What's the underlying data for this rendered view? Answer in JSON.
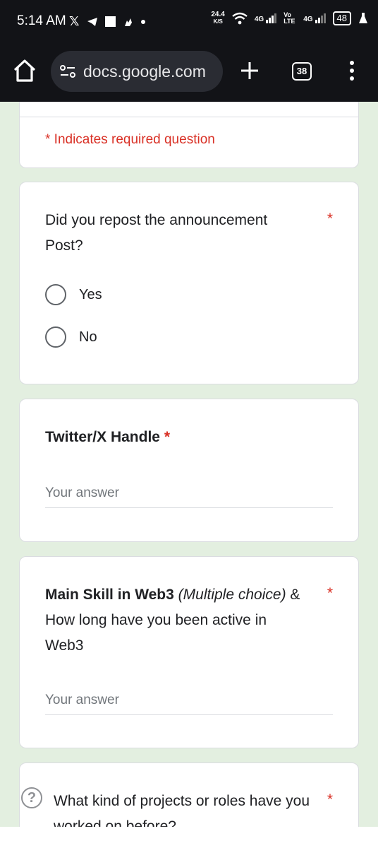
{
  "status_bar": {
    "time": "5:14 AM",
    "left_icons": [
      "x-logo-icon",
      "telegram-icon",
      "square-icon",
      "pan-icon",
      "dot-icon"
    ],
    "net_speed_value": "24.4",
    "net_speed_unit": "K/S",
    "sim1_label": "4G",
    "volte_label": "Vo LTE",
    "sim2_label": "4G",
    "battery": "48"
  },
  "browser": {
    "url": "docs.google.com",
    "tab_count": "38"
  },
  "form": {
    "required_note": "* Indicates required question",
    "q1": {
      "text": "Did you repost the announcement Post?",
      "required": "*",
      "options": [
        "Yes",
        "No"
      ]
    },
    "q2": {
      "text": "Twitter/X Handle",
      "required": "*",
      "placeholder": "Your answer"
    },
    "q3": {
      "bold": "Main Skill in Web3",
      "italic": "(Multiple choice)",
      "rest": "& How long have you been active in Web3",
      "required": "*",
      "placeholder": "Your answer"
    },
    "q4": {
      "help_glyph": "?",
      "text": "What kind of projects or roles have you worked on before?",
      "required": "*"
    }
  }
}
